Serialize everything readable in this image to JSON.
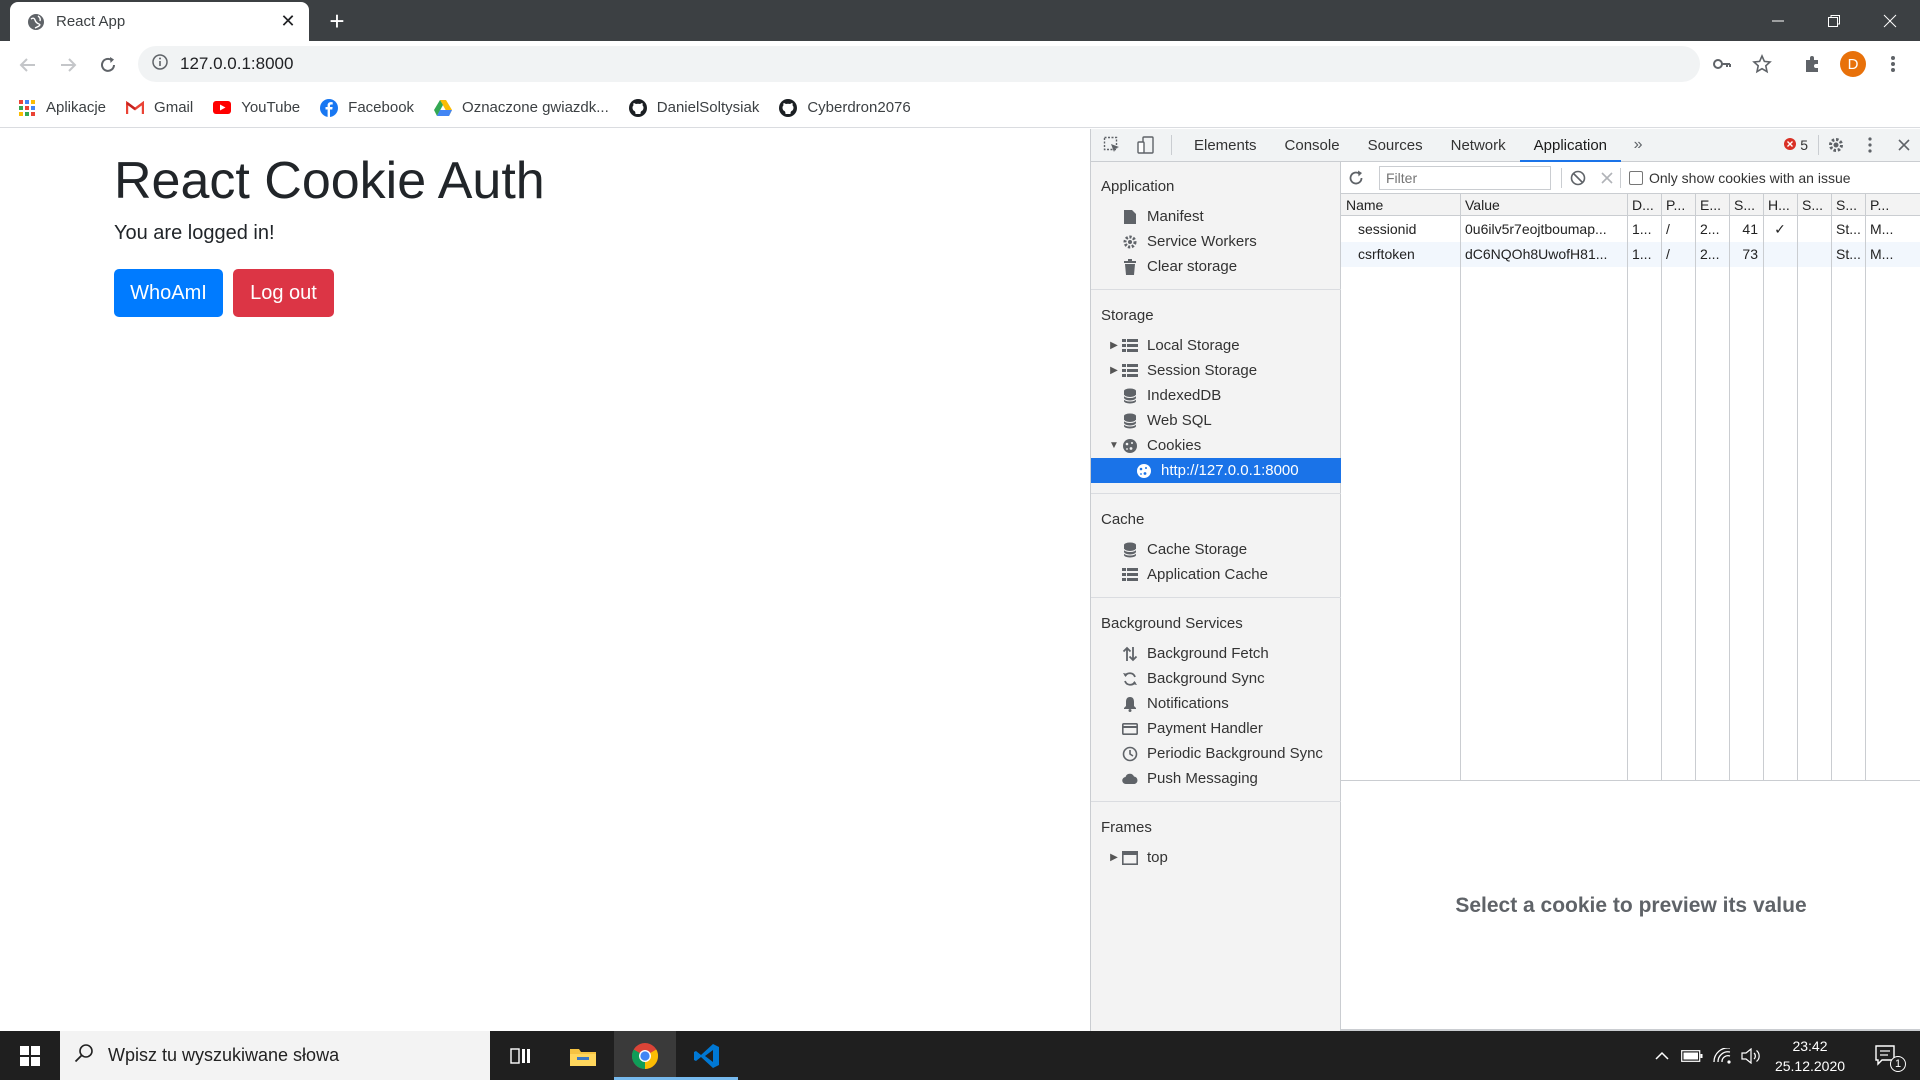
{
  "browser": {
    "tab_title": "React App",
    "url": "127.0.0.1:8000",
    "profile_initial": "D",
    "bookmarks": [
      "Aplikacje",
      "Gmail",
      "YouTube",
      "Facebook",
      "Oznaczone gwiazdk...",
      "DanielSoltysiak",
      "Cyberdron2076"
    ]
  },
  "page": {
    "title": "React Cookie Auth",
    "status": "You are logged in!",
    "whoami_label": "WhoAmI",
    "logout_label": "Log out"
  },
  "devtools": {
    "tabs": [
      "Elements",
      "Console",
      "Sources",
      "Network",
      "Application"
    ],
    "error_count": "5",
    "sidebar": {
      "application": {
        "title": "Application",
        "items": [
          "Manifest",
          "Service Workers",
          "Clear storage"
        ]
      },
      "storage": {
        "title": "Storage",
        "items": [
          "Local Storage",
          "Session Storage",
          "IndexedDB",
          "Web SQL",
          "Cookies",
          "http://127.0.0.1:8000"
        ]
      },
      "cache": {
        "title": "Cache",
        "items": [
          "Cache Storage",
          "Application Cache"
        ]
      },
      "background": {
        "title": "Background Services",
        "items": [
          "Background Fetch",
          "Background Sync",
          "Notifications",
          "Payment Handler",
          "Periodic Background Sync",
          "Push Messaging"
        ]
      },
      "frames": {
        "title": "Frames",
        "items": [
          "top"
        ]
      }
    },
    "filter_placeholder": "Filter",
    "only_issue_label": "Only show cookies with an issue",
    "columns": [
      "Name",
      "Value",
      "D...",
      "P...",
      "E...",
      "S...",
      "H...",
      "S...",
      "S...",
      "P..."
    ],
    "rows": [
      [
        "sessionid",
        "0u6ilv5r7eojtboumap...",
        "1...",
        "/",
        "2...",
        "41",
        "✓",
        "",
        "St...",
        "M..."
      ],
      [
        "csrftoken",
        "dC6NQOh8UwofH81...",
        "1...",
        "/",
        "2...",
        "73",
        "",
        "",
        "St...",
        "M..."
      ]
    ],
    "preview_text": "Select a cookie to preview its value"
  },
  "taskbar": {
    "search_placeholder": "Wpisz tu wyszukiwane słowa",
    "time": "23:42",
    "date": "25.12.2020",
    "notification_count": "1"
  }
}
